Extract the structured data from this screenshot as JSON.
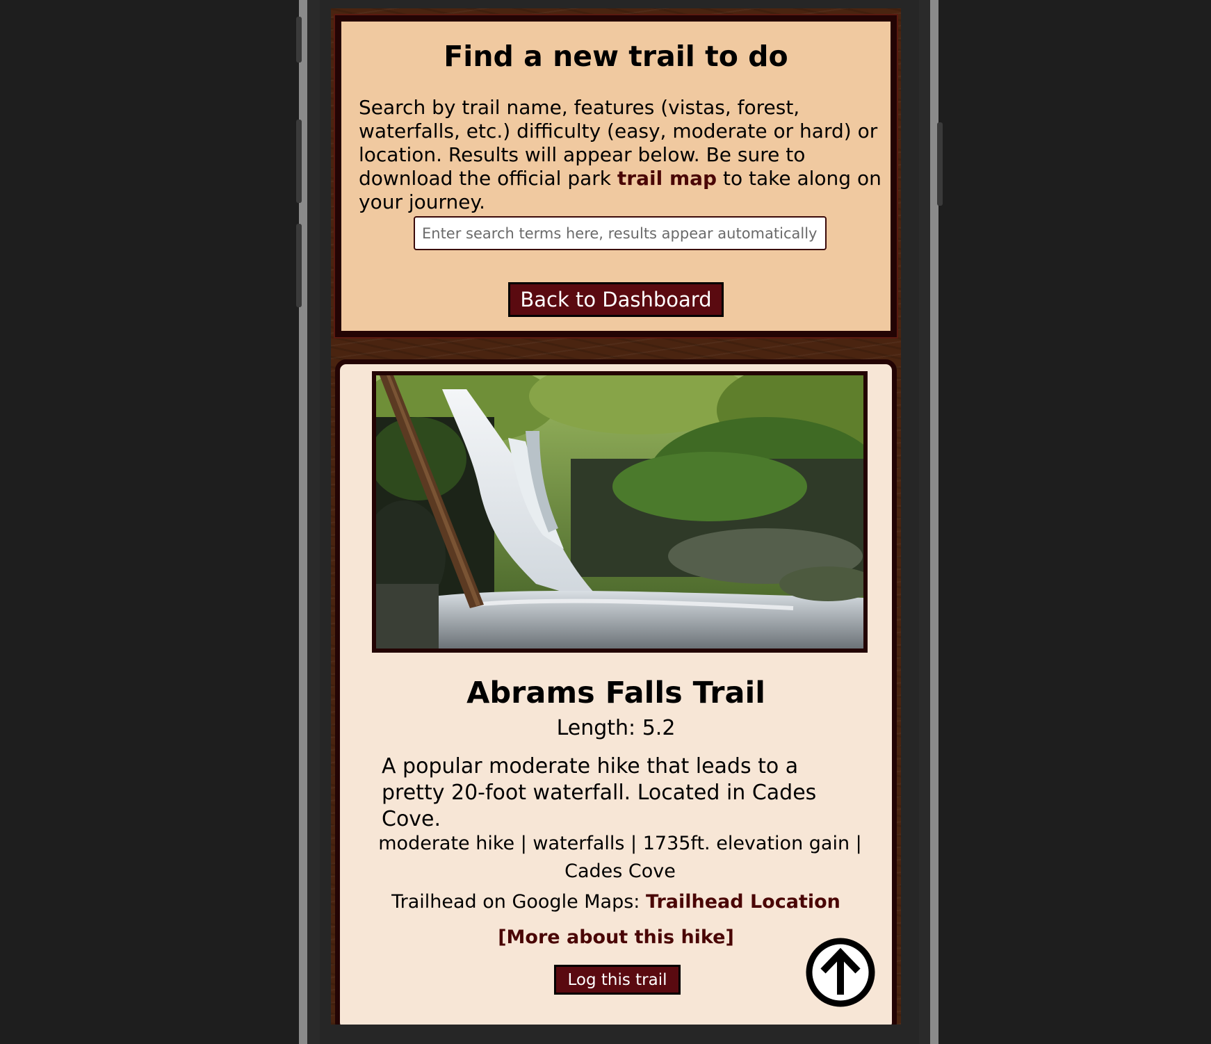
{
  "search_panel": {
    "title": "Find a new trail to do",
    "description_before": "Search by trail name, features (vistas, forest, waterfalls, etc.) difficulty (easy, moderate or hard) or location. Results will appear below. Be sure to download the official park ",
    "trail_map_link": "trail map",
    "description_after": " to take along on your journey.",
    "search_placeholder": "Enter search terms here, results appear automatically",
    "search_value": "",
    "back_button": "Back to Dashboard"
  },
  "trail": {
    "name": "Abrams Falls Trail",
    "length": "Length: 5.2",
    "description": "A popular moderate hike that leads to a pretty 20-foot waterfall. Located in Cades Cove.",
    "tags": "moderate hike | waterfalls | 1735ft. elevation gain | Cades Cove",
    "maps_label": "Trailhead on Google Maps: ",
    "maps_link": "Trailhead Location",
    "more_link": "[More about this hike]",
    "log_button": "Log this trail",
    "photo_subject": "waterfall-photo"
  },
  "icons": {
    "scroll_top": "arrow-up-circle-icon"
  },
  "colors": {
    "panel_bg": "#f0c9a0",
    "card_bg": "#f7e6d6",
    "border": "#230404",
    "button_bg": "#5a0a10",
    "link": "#4a0606",
    "wood": "#4a2410"
  }
}
